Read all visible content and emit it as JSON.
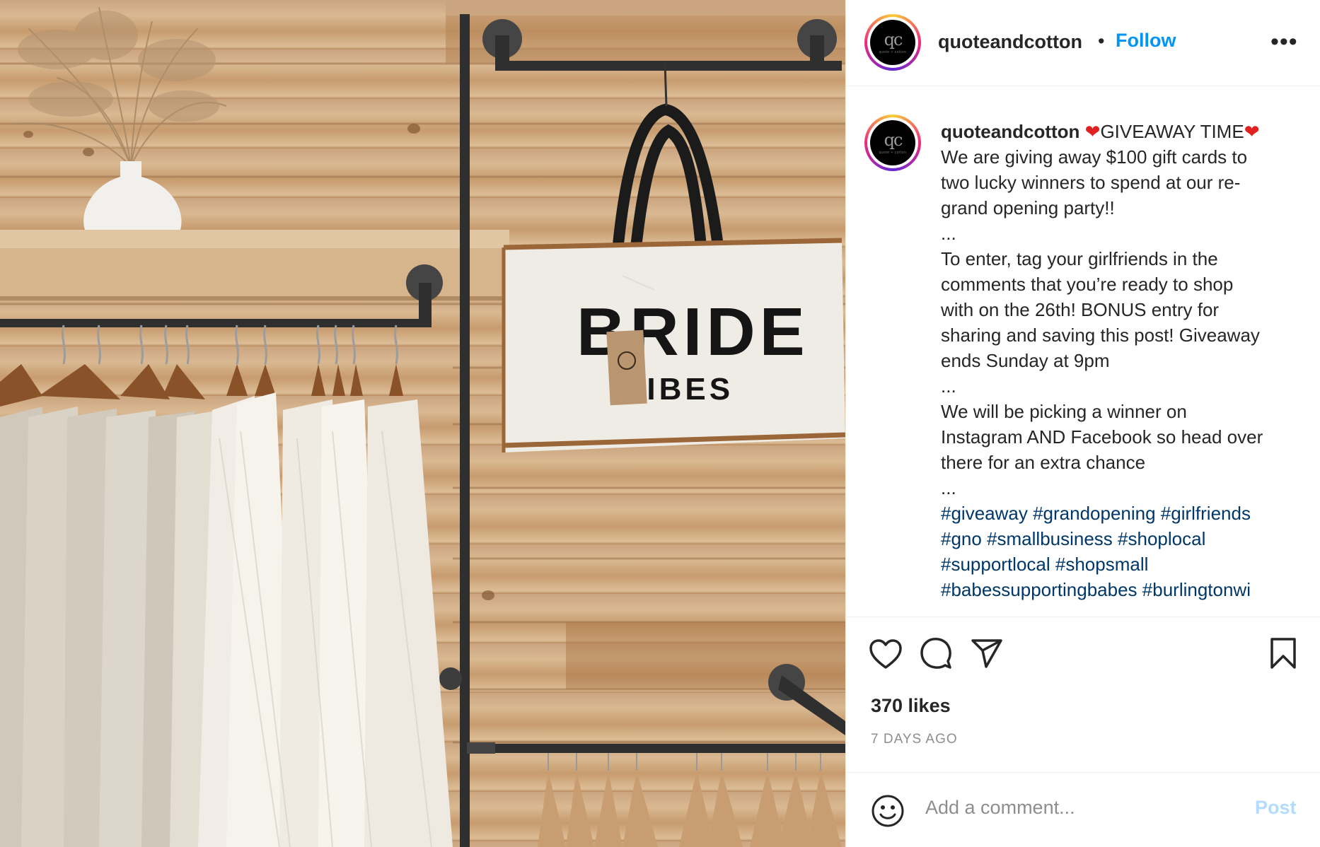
{
  "post": {
    "image_alt": "Boutique clothing rack with a BRIDE VIBES tote bag",
    "bag_text_line1": "BRIDE",
    "bag_text_line2": "VIBES"
  },
  "header": {
    "avatar_monogram": "qc",
    "avatar_subtext": "quote + cotton",
    "username": "quoteandcotton",
    "separator": "•",
    "follow_label": "Follow",
    "more_label": "•••"
  },
  "caption": {
    "username": "quoteandcotton",
    "heart": "❤",
    "headline": "GIVEAWAY TIME",
    "lines": [
      "We are giving away $100 gift cards to",
      "two lucky winners to spend at our re-",
      "grand opening party!!",
      "...",
      "To enter, tag your girlfriends in the",
      "comments that you’re ready to shop",
      "with on the 26th! BONUS entry for",
      "sharing and saving this post! Giveaway",
      "ends Sunday at 9pm",
      "...",
      "We will be picking a winner on",
      "Instagram AND Facebook so head over",
      "there for an extra chance",
      "..."
    ],
    "hashtag_lines": [
      "#giveaway #grandopening #girlfriends",
      "#gno #smallbusiness #shoplocal",
      "#supportlocal #shopsmall",
      "#babessupportingbabes #burlingtonwi"
    ]
  },
  "actions": {
    "like_icon": "heart-outline-icon",
    "comment_icon": "comment-bubble-icon",
    "share_icon": "paper-plane-icon",
    "save_icon": "bookmark-icon"
  },
  "likes": "370 likes",
  "time": "7 DAYS AGO",
  "comment": {
    "placeholder": "Add a comment...",
    "post_label": "Post",
    "emoji_icon": "smiley-icon"
  },
  "colors": {
    "accent": "#0095f6",
    "hashtag": "#00376b",
    "post_disabled": "#b3dbff",
    "muted": "#8e8e8e"
  }
}
